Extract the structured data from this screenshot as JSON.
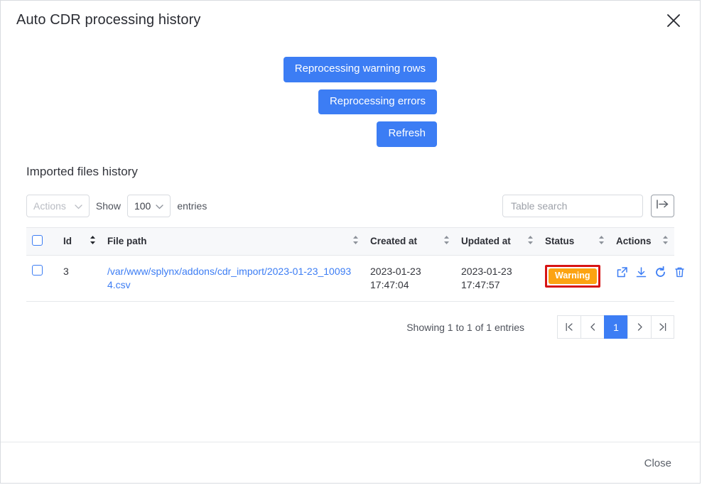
{
  "dialog": {
    "title": "Auto CDR processing history",
    "close_icon": "close-x-icon",
    "footer_close_label": "Close"
  },
  "actions_bar": {
    "buttons": [
      {
        "label": "Reprocessing warning rows",
        "name": "reprocessing-warning-rows-button"
      },
      {
        "label": "Reprocessing errors",
        "name": "reprocessing-errors-button"
      },
      {
        "label": "Refresh",
        "name": "refresh-button"
      }
    ]
  },
  "section": {
    "title": "Imported files history"
  },
  "toolbar": {
    "actions_select_label": "Actions",
    "show_label": "Show",
    "page_length_value": "100",
    "entries_label": "entries",
    "search_placeholder": "Table search",
    "export_icon": "export-arrow-icon"
  },
  "table": {
    "columns": [
      {
        "label": "Id",
        "sortable": true
      },
      {
        "label": "File path",
        "sortable": true
      },
      {
        "label": "Created at",
        "sortable": true
      },
      {
        "label": "Updated at",
        "sortable": true
      },
      {
        "label": "Status",
        "sortable": true
      },
      {
        "label": "Actions",
        "sortable": true
      }
    ],
    "rows": [
      {
        "id": "3",
        "file_path": "/var/www/splynx/addons/cdr_import/2023-01-23_100934.csv",
        "created_at": "2023-01-23 17:47:04",
        "updated_at": "2023-01-23 17:47:57",
        "status": "Warning",
        "actions": [
          "external-link-icon",
          "download-icon",
          "refresh-icon",
          "trash-icon"
        ]
      }
    ]
  },
  "pagination": {
    "showing_text": "Showing 1 to 1 of 1 entries",
    "first_label": "|<",
    "prev_label": "<",
    "current_page": "1",
    "next_label": ">",
    "last_label": ">|"
  },
  "colors": {
    "primary_blue": "#3c7df4",
    "warning_orange": "#fca312",
    "highlight_red": "#d71414",
    "border_gray": "#e6e8eb"
  }
}
